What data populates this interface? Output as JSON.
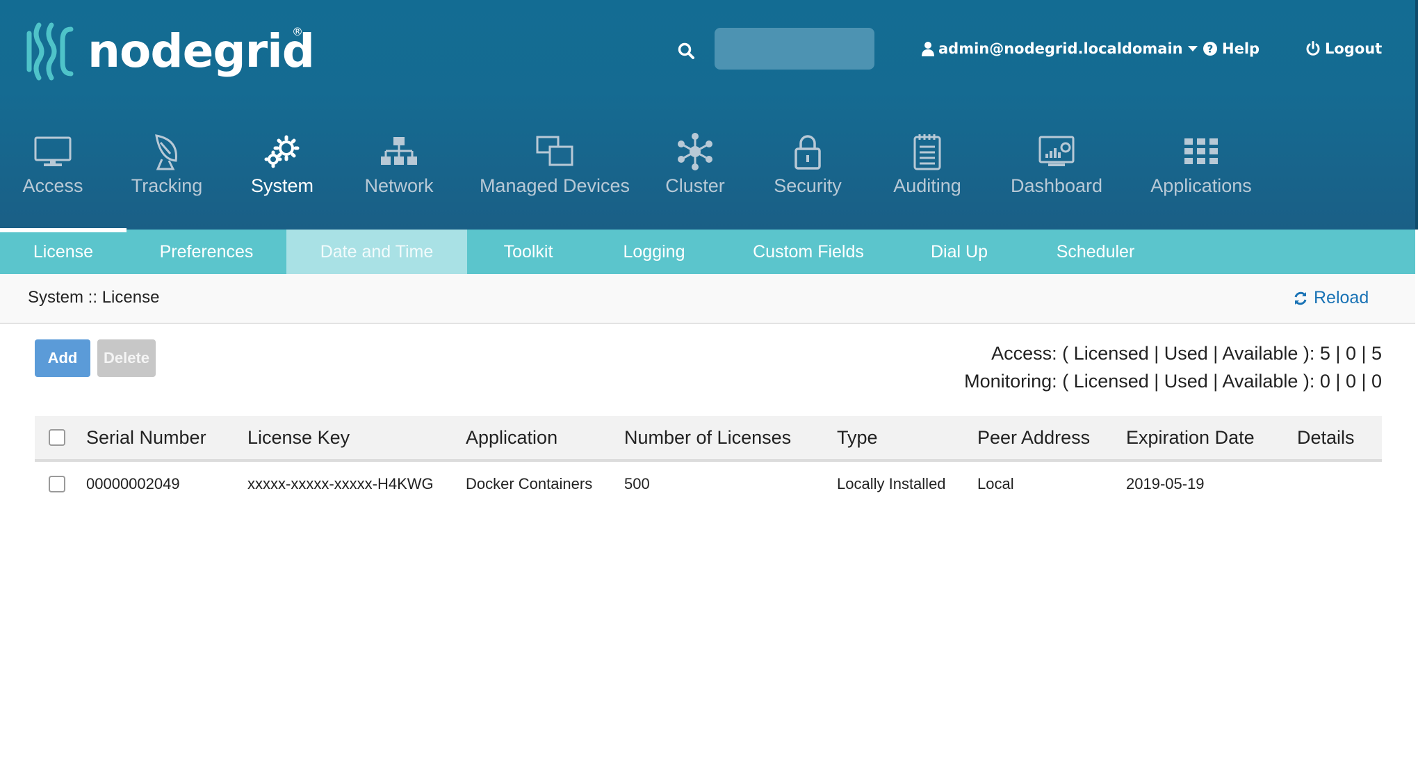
{
  "header": {
    "brand": "nodegrid",
    "search": {
      "placeholder": "",
      "value": ""
    },
    "user": {
      "label": "admin@nodegrid.localdomain"
    },
    "help": {
      "label": "Help"
    },
    "logout": {
      "label": "Logout"
    }
  },
  "main_nav": {
    "active": "System",
    "items": [
      {
        "label": "Access",
        "icon": "monitor-icon"
      },
      {
        "label": "Tracking",
        "icon": "satellite-dish-icon"
      },
      {
        "label": "System",
        "icon": "gears-icon"
      },
      {
        "label": "Network",
        "icon": "network-icon"
      },
      {
        "label": "Managed Devices",
        "icon": "devices-icon"
      },
      {
        "label": "Cluster",
        "icon": "cluster-icon"
      },
      {
        "label": "Security",
        "icon": "lock-icon"
      },
      {
        "label": "Auditing",
        "icon": "notepad-icon"
      },
      {
        "label": "Dashboard",
        "icon": "dashboard-icon"
      },
      {
        "label": "Applications",
        "icon": "grid-icon"
      }
    ]
  },
  "sub_nav": {
    "active": "License",
    "highlighted": "Date and Time",
    "items": [
      "License",
      "Preferences",
      "Date and Time",
      "Toolkit",
      "Logging",
      "Custom Fields",
      "Dial Up",
      "Scheduler"
    ]
  },
  "breadcrumb": "System :: License",
  "reload": "Reload",
  "actions": {
    "add": "Add",
    "delete": "Delete"
  },
  "license_counts": {
    "access": "Access: ( Licensed | Used | Available ): 5 | 0 | 5",
    "monitoring": "Monitoring: ( Licensed | Used | Available ): 0 | 0 | 0"
  },
  "table": {
    "columns": [
      "Serial Number",
      "License Key",
      "Application",
      "Number of Licenses",
      "Type",
      "Peer Address",
      "Expiration Date",
      "Details"
    ],
    "rows": [
      {
        "serial": "00000002049",
        "key": "xxxxx-xxxxx-xxxxx-H4KWG",
        "application": "Docker Containers",
        "count": "500",
        "type": "Locally Installed",
        "peer": "Local",
        "expiration": "2019-05-19",
        "details": ""
      }
    ]
  },
  "colors": {
    "header_bg": "#136c93",
    "subnav_bg": "#5bc5cc",
    "subnav_highlight": "#a9e1e5",
    "add_button": "#5b9bd8",
    "delete_button": "#c7c7c7",
    "link": "#1a73b5"
  }
}
